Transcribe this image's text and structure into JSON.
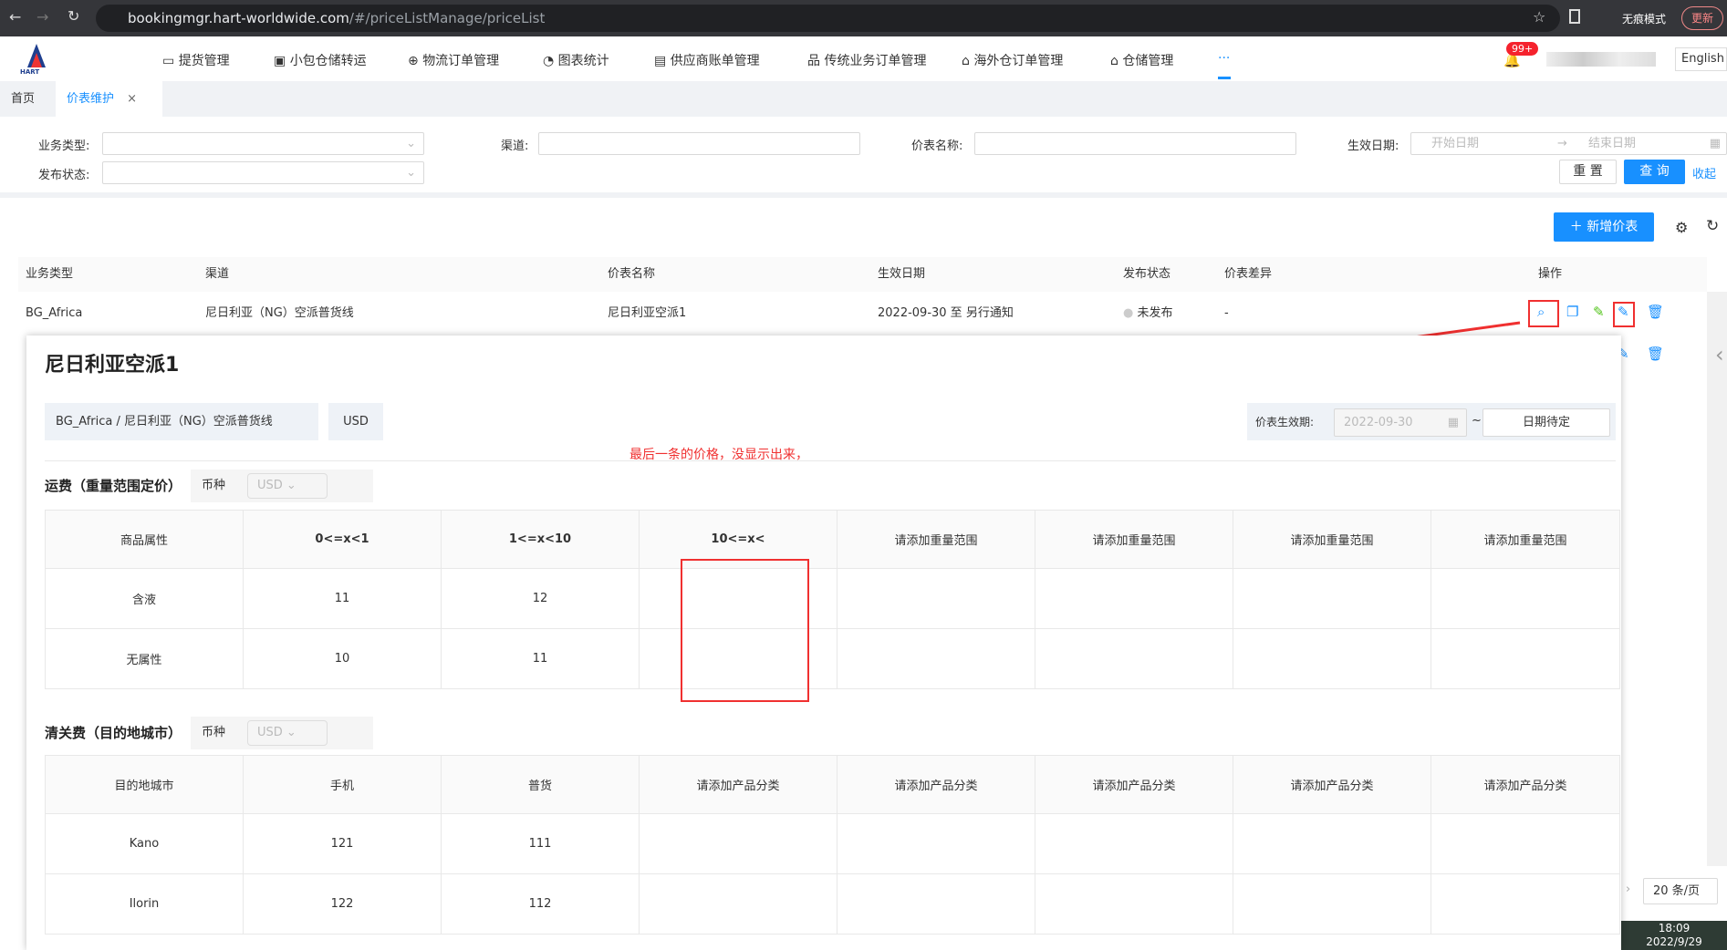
{
  "browser": {
    "url_host": "bookingmgr.hart-worldwide.com",
    "url_path": "/#/priceListManage/priceList",
    "incognito": "无痕模式",
    "update": "更新"
  },
  "header": {
    "logo": "HART",
    "nav": [
      "提货管理",
      "小包仓储转运",
      "物流订单管理",
      "图表统计",
      "供应商账单管理",
      "传统业务订单管理",
      "海外仓订单管理",
      "仓储管理",
      "···"
    ],
    "badge": "99+",
    "language": "English"
  },
  "tabs": [
    {
      "label": "首页"
    },
    {
      "label": "价表维护"
    }
  ],
  "filters": {
    "business_type": "业务类型:",
    "channel": "渠道:",
    "price_name": "价表名称:",
    "effective_date": "生效日期:",
    "start_placeholder": "开始日期",
    "end_placeholder": "结束日期",
    "publish_status": "发布状态:",
    "reset": "重 置",
    "query": "查 询",
    "collapse": "收起"
  },
  "toolbar": {
    "add": "新增价表"
  },
  "table": {
    "columns": [
      "业务类型",
      "渠道",
      "价表名称",
      "生效日期",
      "发布状态",
      "价表差异",
      "操作"
    ],
    "rows": [
      {
        "type": "BG_Africa",
        "channel": "尼日利亚（NG）空派普货线",
        "name": "尼日利亚空派1",
        "date": "2022-09-30 至 另行通知",
        "status": "未发布",
        "diff": "-"
      }
    ]
  },
  "pagination": {
    "page_size": "20 条/页"
  },
  "taskbar": {
    "time": "18:09",
    "date": "2022/9/29"
  },
  "modal": {
    "title": "尼日利亚空派1",
    "path": "BG_Africa / 尼日利亚（NG）空派普货线",
    "currency": "USD",
    "effective_label": "价表生效期:",
    "effective_start": "2022-09-30",
    "tilde": "~",
    "effective_end": "日期待定",
    "annotation": "最后一条的价格，没显示出来，",
    "freight": {
      "title": "运费（重量范围定价）",
      "currency_label": "币种",
      "currency": "USD",
      "header": [
        "商品属性",
        "0<=x<1",
        "1<=x<10",
        "10<=x<",
        "请添加重量范围",
        "请添加重量范围",
        "请添加重量范围",
        "请添加重量范围"
      ],
      "rows": [
        [
          "含液",
          "11",
          "12",
          "",
          "",
          "",
          "",
          ""
        ],
        [
          "无属性",
          "10",
          "11",
          "",
          "",
          "",
          "",
          ""
        ]
      ]
    },
    "clearance": {
      "title": "清关费（目的地城市）",
      "currency_label": "币种",
      "currency": "USD",
      "header": [
        "目的地城市",
        "手机",
        "普货",
        "请添加产品分类",
        "请添加产品分类",
        "请添加产品分类",
        "请添加产品分类",
        "请添加产品分类"
      ],
      "rows": [
        [
          "Kano",
          "121",
          "111",
          "",
          "",
          "",
          "",
          ""
        ],
        [
          "Ilorin",
          "122",
          "112",
          "",
          "",
          "",
          "",
          ""
        ]
      ]
    }
  }
}
